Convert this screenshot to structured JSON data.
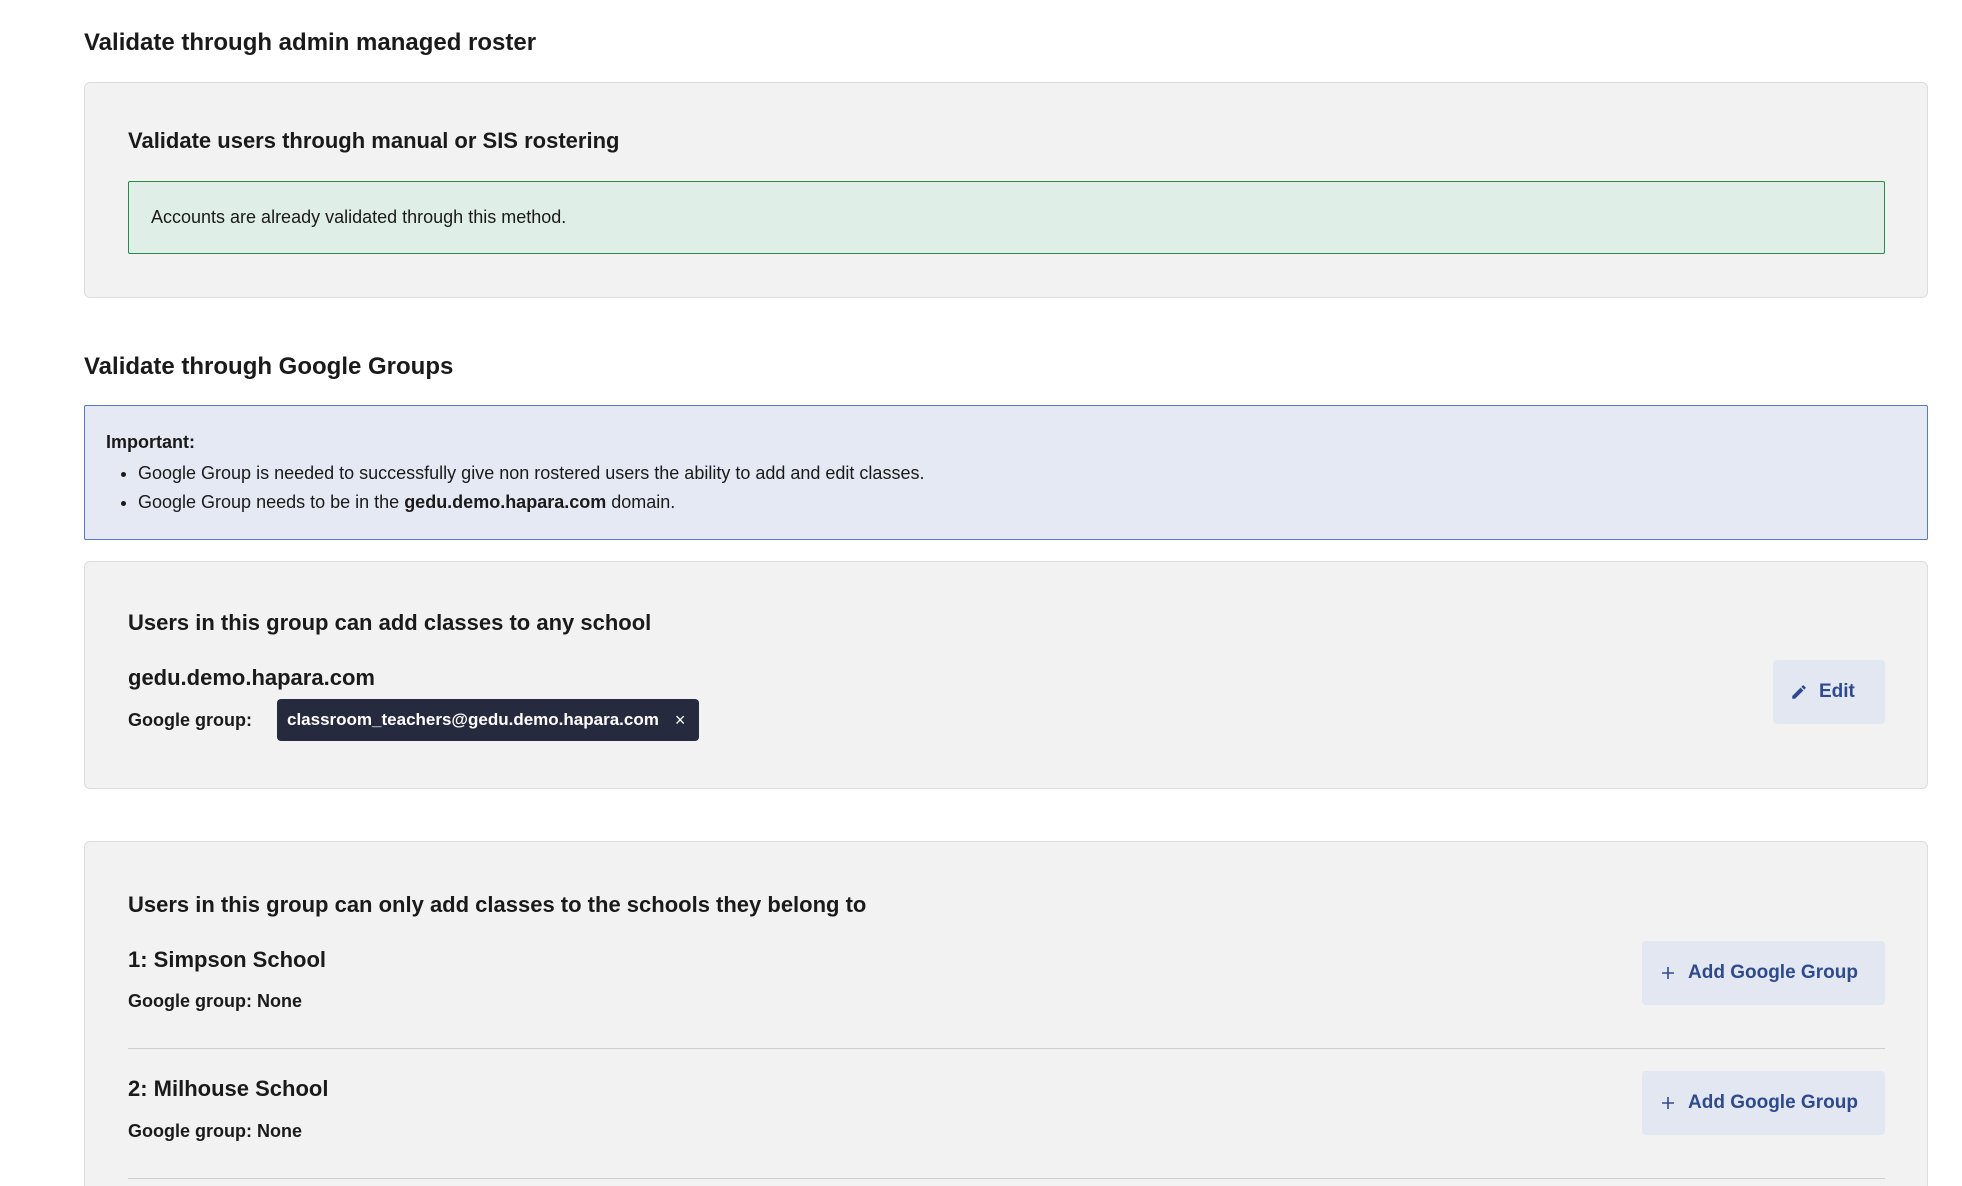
{
  "roster_section": {
    "title": "Validate through admin managed roster",
    "card_title": "Validate users through manual or SIS rostering",
    "success_message": "Accounts are already validated through this method."
  },
  "google_groups_section": {
    "title": "Validate through Google Groups",
    "info": {
      "heading": "Important:",
      "bullet_1": "Google Group is needed to successfully give non rostered users the ability to add and edit classes.",
      "bullet_2_prefix": "Google Group needs to be in the ",
      "bullet_2_domain": "gedu.demo.hapara.com",
      "bullet_2_suffix": " domain."
    },
    "any_school_card": {
      "title": "Users in this group can add classes to any school",
      "domain": "gedu.demo.hapara.com",
      "group_label": "Google group:",
      "group_chip": "classroom_teachers@gedu.demo.hapara.com",
      "chip_remove": "×",
      "edit_label": "Edit",
      "edit_icon": "pencil-icon"
    },
    "own_school_card": {
      "title": "Users in this group can only add classes to the schools they belong to",
      "add_icon": "plus-icon",
      "schools": [
        {
          "name": "1: Simpson School",
          "group": "Google group: None",
          "button": "Add Google Group"
        },
        {
          "name": "2: Milhouse School",
          "group": "Google group: None",
          "button": "Add Google Group"
        }
      ]
    }
  }
}
